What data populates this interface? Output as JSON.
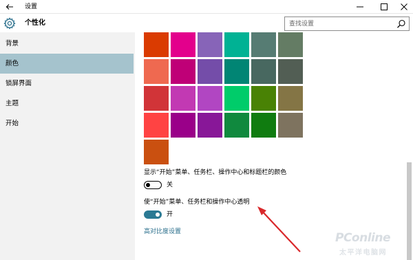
{
  "window": {
    "title": "设置"
  },
  "header": {
    "app_title": "个性化",
    "search_placeholder": "查找设置"
  },
  "sidebar": {
    "items": [
      {
        "label": "背景"
      },
      {
        "label": "颜色",
        "active": true
      },
      {
        "label": "锁屏界面"
      },
      {
        "label": "主题"
      },
      {
        "label": "开始"
      }
    ]
  },
  "colors": {
    "rows": [
      [
        "#da3b01",
        "#e3008c",
        "#8764b8",
        "#00b294",
        "#567c73",
        "#647c64"
      ],
      [
        "#ef6950",
        "#bf0077",
        "#744da9",
        "#018574",
        "#486860",
        "#525e54"
      ],
      [
        "#d13438",
        "#c239b3",
        "#b146c2",
        "#00cc6a",
        "#498205",
        "#847545"
      ],
      [
        "#ff4343",
        "#9a0089",
        "#881798",
        "#10893e",
        "#107c10",
        "#7e735f"
      ],
      [
        "#ca5010"
      ]
    ],
    "active_toggle": "#2b7a94",
    "link": "#2b6f8c",
    "selected_nav": "#a5c3cd"
  },
  "options": {
    "show_color_label": "显示“开始”菜单、任务栏、操作中心和标题栏的颜色",
    "show_color_state": "关",
    "show_color_on": false,
    "transparent_label": "使“开始”菜单、任务栏和操作中心透明",
    "transparent_state": "开",
    "transparent_on": true,
    "high_contrast_link": "高对比度设置"
  },
  "watermark": {
    "main": "PConline",
    "sub": "太平洋电脑网"
  },
  "icons": [
    "back-arrow-icon",
    "minimize-icon",
    "maximize-icon",
    "close-icon",
    "gear-icon",
    "search-icon"
  ]
}
